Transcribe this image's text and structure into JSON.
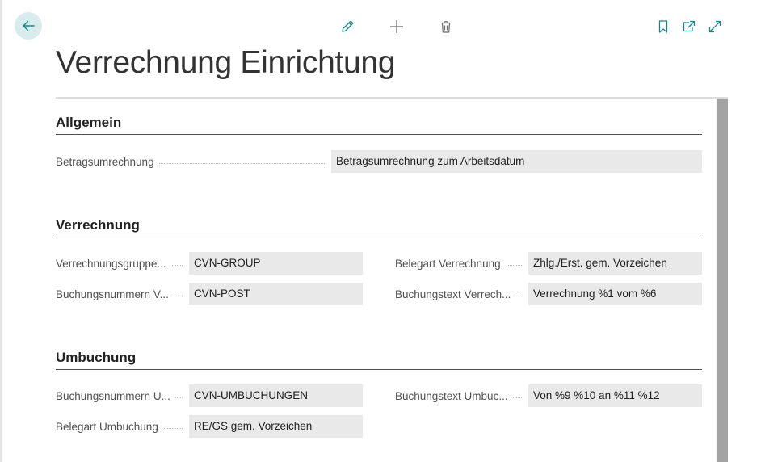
{
  "colors": {
    "accent": "#0e8894",
    "back_bg": "#d8ecee",
    "field_bg": "#e9e9e9"
  },
  "toolbar": {
    "back_icon": "arrow-left-icon",
    "edit_icon": "pencil-icon",
    "new_icon": "plus-icon",
    "delete_icon": "trash-icon",
    "bookmark_icon": "bookmark-icon",
    "open_new_window_icon": "open-in-new-icon",
    "expand_icon": "expand-icon"
  },
  "page": {
    "title": "Verrechnung Einrichtung"
  },
  "sections": {
    "allgemein": {
      "title": "Allgemein",
      "betragsumrechnung": {
        "label": "Betragsumrechnung",
        "value": "Betragsumrechnung zum Arbeitsdatum"
      }
    },
    "verrechnung": {
      "title": "Verrechnung",
      "verrechnungsgruppe": {
        "label": "Verrechnungsgruppe...",
        "value": "CVN-GROUP"
      },
      "buchungsnummern": {
        "label": "Buchungsnummern V...",
        "value": "CVN-POST"
      },
      "belegart": {
        "label": "Belegart Verrechnung",
        "value": "Zhlg./Erst. gem. Vorzeichen"
      },
      "buchungstext": {
        "label": "Buchungstext Verrech...",
        "value": "Verrechnung %1 vom %6"
      }
    },
    "umbuchung": {
      "title": "Umbuchung",
      "buchungsnummern": {
        "label": "Buchungsnummern U...",
        "value": "CVN-UMBUCHUNGEN"
      },
      "belegart": {
        "label": "Belegart Umbuchung",
        "value": "RE/GS gem. Vorzeichen"
      },
      "buchungstext": {
        "label": "Buchungstext Umbuc...",
        "value": "Von %9 %10 an %11 %12"
      }
    }
  }
}
